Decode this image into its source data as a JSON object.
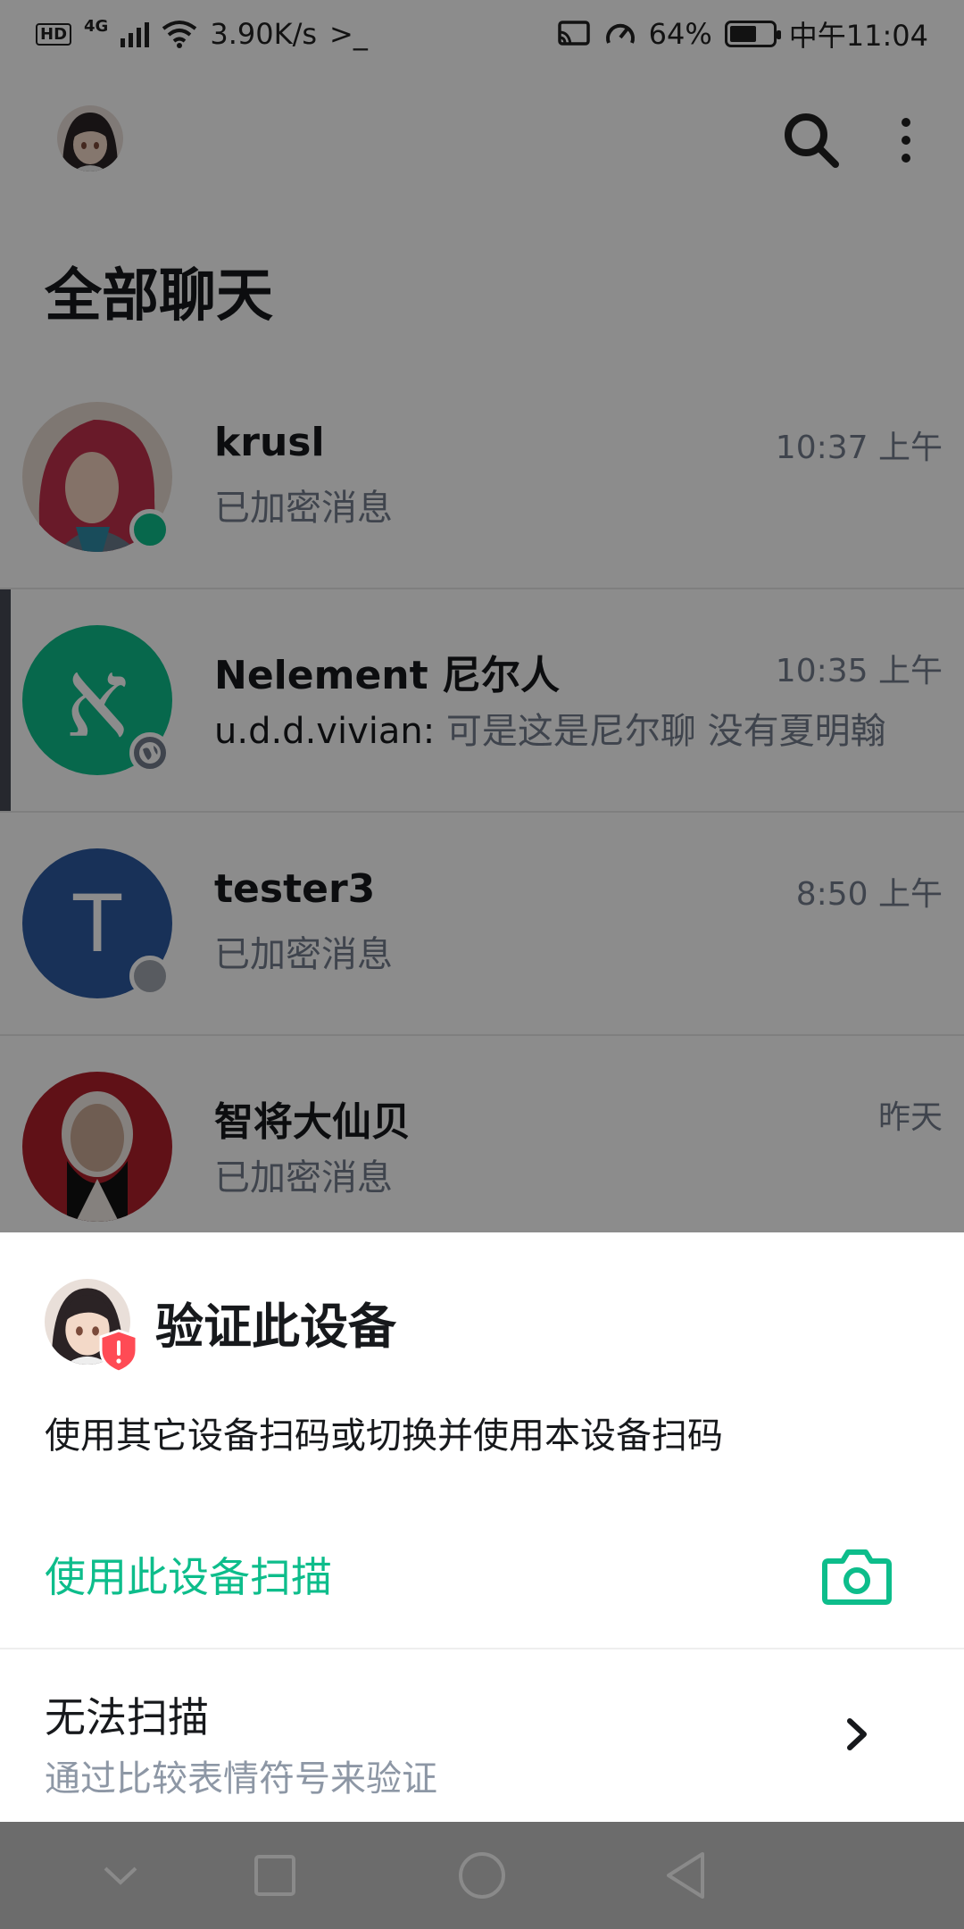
{
  "status_bar": {
    "hd": "HD",
    "network": "4G",
    "speed": "3.90K/s",
    "terminal": ">_",
    "battery_percent": 64,
    "battery_text": "64%",
    "time": "中午11:04"
  },
  "app_bar": {
    "avatar_icon": "user-avatar-icon",
    "search_icon": "search-icon",
    "more_icon": "more-vertical-icon"
  },
  "page": {
    "title": "全部聊天"
  },
  "rooms": [
    {
      "name": "krusl",
      "time": "10:37 上午",
      "preview": "已加密消息",
      "avatar_color": "#c23b3b",
      "presence": "online"
    },
    {
      "name": "Nelement 尼尔人",
      "time": "10:35 上午",
      "sender": "u.d.d.vivian:",
      "preview": " 可是这是尼尔聊 没有夏明翰",
      "avatar_color": "#0dbd8b",
      "avatar_letter": "א",
      "badge_icon": "globe-icon"
    },
    {
      "name": "tester3",
      "time": "8:50 上午",
      "preview": "已加密消息",
      "avatar_color": "#2c5aa0",
      "avatar_letter": "T",
      "presence": "offline"
    },
    {
      "name": "智将大仙贝",
      "time": "昨天",
      "preview": "已加密消息",
      "avatar_color": "#8b1a1a"
    }
  ],
  "sheet": {
    "title": "验证此设备",
    "description": "使用其它设备扫码或切换并使用本设备扫码",
    "scan_label": "使用此设备扫描",
    "scan_icon": "camera-icon",
    "cant_scan_label": "无法扫描",
    "cant_scan_sub": "通过比较表情符号来验证",
    "chevron_icon": "chevron-right-icon",
    "accent": "#0dbd8b"
  },
  "nav_bar": {
    "icons": [
      "chevron-down-icon",
      "recents-square-icon",
      "home-circle-icon",
      "back-triangle-icon"
    ]
  }
}
